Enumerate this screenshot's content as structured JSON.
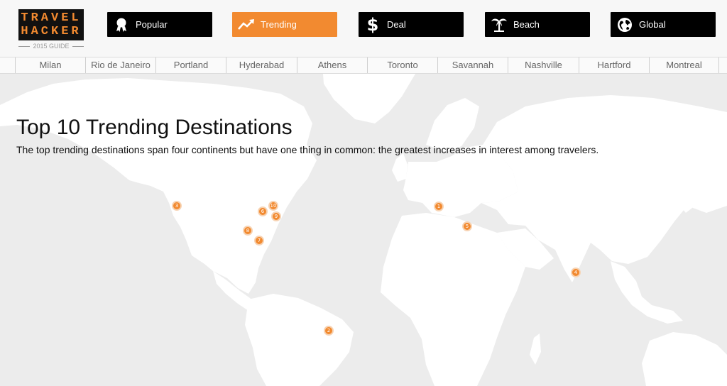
{
  "logo": {
    "line1": "TRAVEL",
    "line2": "HACKER",
    "sub": "2015 GUIDE"
  },
  "nav": [
    {
      "label": "Popular",
      "icon": "award-ribbon-icon"
    },
    {
      "label": "Trending",
      "icon": "trending-up-icon",
      "active": true
    },
    {
      "label": "Deal",
      "icon": "dollar-sign-icon"
    },
    {
      "label": "Beach",
      "icon": "palm-tree-icon"
    },
    {
      "label": "Global",
      "icon": "globe-icon"
    }
  ],
  "cities": [
    "Milan",
    "Rio de Janeiro",
    "Portland",
    "Hyderabad",
    "Athens",
    "Toronto",
    "Savannah",
    "Nashville",
    "Hartford",
    "Montreal"
  ],
  "main": {
    "title": "Top 10 Trending Destinations",
    "subtitle": "The top trending destinations span four continents but have one thing in common: the greatest increases in interest among travelers."
  },
  "markers": [
    "1",
    "2",
    "3",
    "4",
    "5",
    "6",
    "7",
    "8",
    "9",
    "10"
  ],
  "colors": {
    "accent": "#f28a30",
    "nav_bg": "#000000",
    "map_land": "#ffffff",
    "map_water": "#ececec"
  }
}
